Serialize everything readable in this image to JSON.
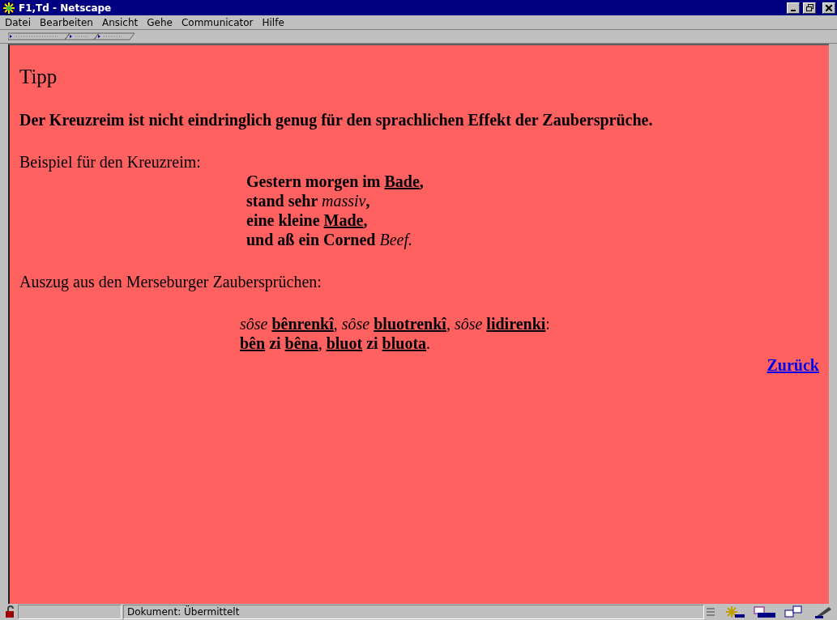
{
  "window": {
    "title": "F1,Td - Netscape"
  },
  "menu": [
    {
      "label": "Datei"
    },
    {
      "label": "Bearbeiten"
    },
    {
      "label": "Ansicht"
    },
    {
      "label": "Gehe"
    },
    {
      "label": "Communicator"
    },
    {
      "label": "Hilfe"
    }
  ],
  "page": {
    "heading": "Tipp",
    "intro": "Der Kreuzreim ist nicht eindringlich genug für den sprachlichen Effekt der Zaubersprüche.",
    "example_label": "Beispiel für den Kreuzreim:",
    "poem": [
      [
        {
          "text": "Gestern morgen im ",
          "kind": "bold"
        },
        {
          "text": "Bade",
          "kind": "underline"
        },
        {
          "text": ",",
          "kind": "bold"
        }
      ],
      [
        {
          "text": "stand sehr ",
          "kind": "bold"
        },
        {
          "text": "massiv",
          "kind": "italic"
        },
        {
          "text": ",",
          "kind": "bold"
        }
      ],
      [
        {
          "text": "eine kleine ",
          "kind": "bold"
        },
        {
          "text": "Made",
          "kind": "underline"
        },
        {
          "text": ",",
          "kind": "bold"
        }
      ],
      [
        {
          "text": "und aß ein Corned ",
          "kind": "bold"
        },
        {
          "text": "Beef.",
          "kind": "italic"
        }
      ]
    ],
    "excerpt_label": "Auszug aus den Merseburger Zaubersprüchen:",
    "spell": [
      [
        {
          "text": "sôse ",
          "kind": "italic"
        },
        {
          "text": "bênrenkî",
          "kind": "underline"
        },
        {
          "text": ", ",
          "kind": "plain"
        },
        {
          "text": "sôse ",
          "kind": "italic"
        },
        {
          "text": "bluotrenkî",
          "kind": "underline"
        },
        {
          "text": ", ",
          "kind": "plain"
        },
        {
          "text": "sôse ",
          "kind": "italic"
        },
        {
          "text": "lidirenki",
          "kind": "underline"
        },
        {
          "text": ":",
          "kind": "plain"
        }
      ],
      [
        {
          "text": "bên",
          "kind": "underline"
        },
        {
          "text": " zi ",
          "kind": "bold"
        },
        {
          "text": "bêna",
          "kind": "underline"
        },
        {
          "text": ", ",
          "kind": "plain"
        },
        {
          "text": "bluot",
          "kind": "underline"
        },
        {
          "text": " zi ",
          "kind": "bold"
        },
        {
          "text": "bluota",
          "kind": "underline"
        },
        {
          "text": ".",
          "kind": "plain"
        }
      ]
    ],
    "back_link": "Zurück"
  },
  "status_bar": {
    "text": "Dokument: Übermittelt"
  }
}
